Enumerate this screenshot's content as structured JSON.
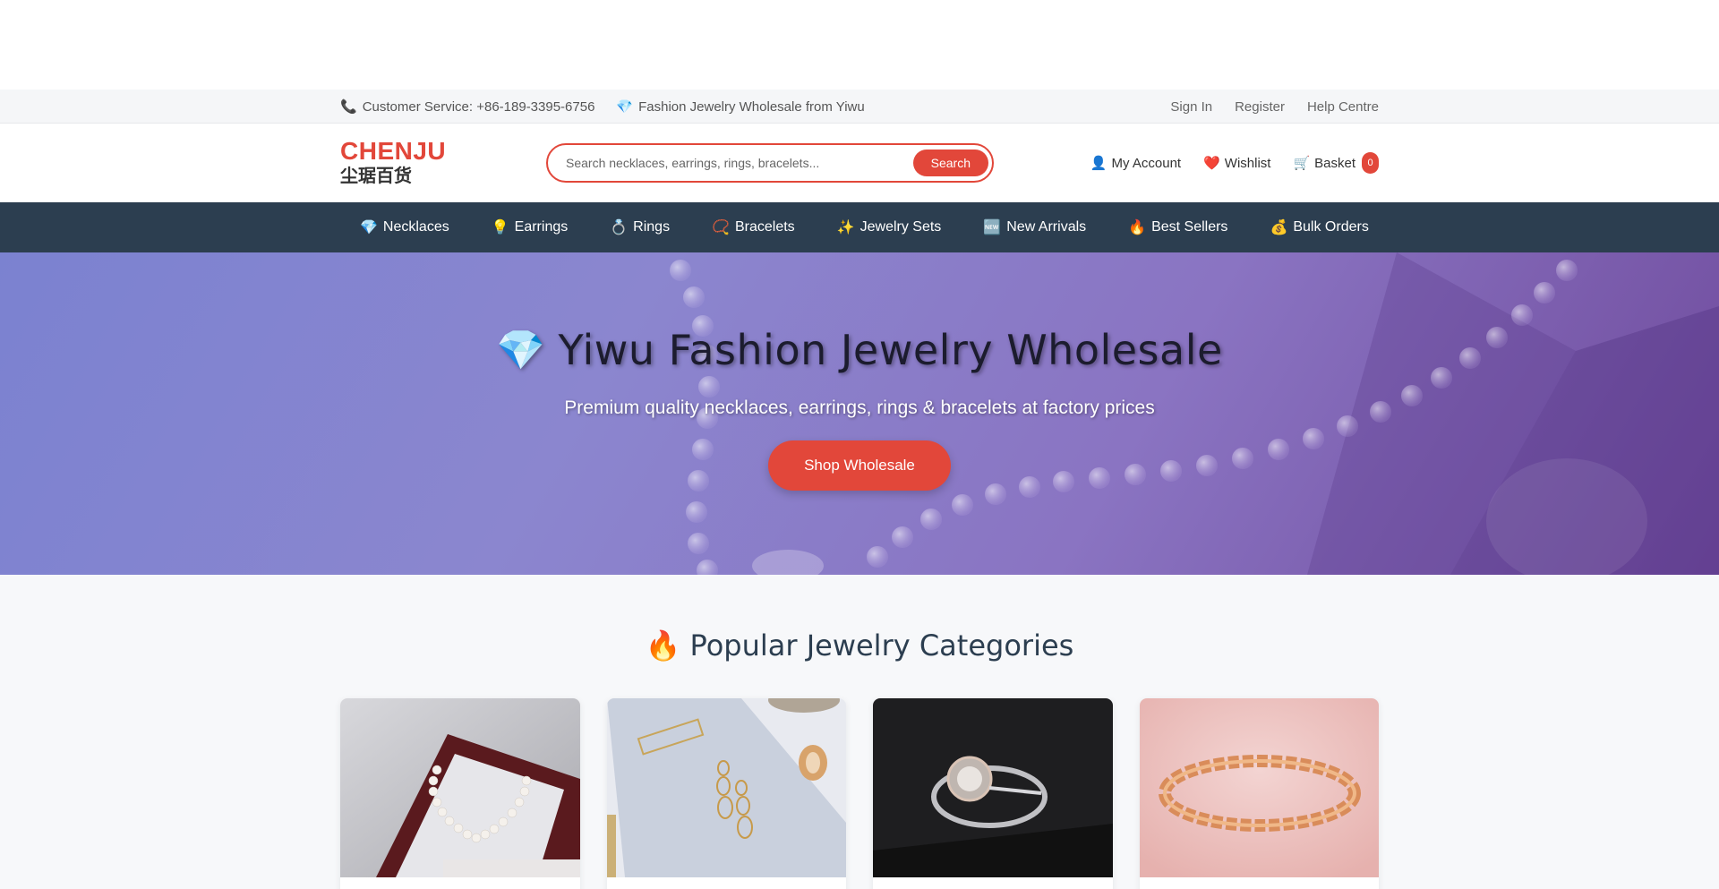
{
  "topbar": {
    "phone_icon": "phone-icon",
    "customer_service": "Customer Service: +86-189-3395-6756",
    "gem_icon": "gem-icon",
    "tagline": "Fashion Jewelry Wholesale from Yiwu",
    "links": [
      "Sign In",
      "Register",
      "Help Centre"
    ]
  },
  "header": {
    "brand": "CHENJU",
    "brand_cn": "尘琚百货",
    "search_placeholder": "Search necklaces, earrings, rings, bracelets...",
    "search_button": "Search",
    "account": "My Account",
    "wishlist": "Wishlist",
    "basket": "Basket",
    "basket_count": "0"
  },
  "nav": {
    "items": [
      {
        "icon": "💎",
        "label": "Necklaces"
      },
      {
        "icon": "💡",
        "label": "Earrings"
      },
      {
        "icon": "💍",
        "label": "Rings"
      },
      {
        "icon": "📿",
        "label": "Bracelets"
      },
      {
        "icon": "✨",
        "label": "Jewelry Sets"
      },
      {
        "icon": "🆕",
        "label": "New Arrivals"
      },
      {
        "icon": "🔥",
        "label": "Best Sellers"
      },
      {
        "icon": "💰",
        "label": "Bulk Orders"
      }
    ]
  },
  "hero": {
    "icon": "💎",
    "title": "Yiwu Fashion Jewelry Wholesale",
    "subtitle": "Premium quality necklaces, earrings, rings & bracelets at factory prices",
    "cta": "Shop Wholesale"
  },
  "categories": {
    "icon": "🔥",
    "title": "Popular Jewelry Categories",
    "cards": [
      {
        "image": "pearl-necklace-image"
      },
      {
        "image": "gold-earrings-image"
      },
      {
        "image": "diamond-ring-image"
      },
      {
        "image": "rose-gold-bracelet-image"
      }
    ]
  },
  "colors": {
    "accent": "#e2473a",
    "nav_bg": "#2c3e50"
  }
}
